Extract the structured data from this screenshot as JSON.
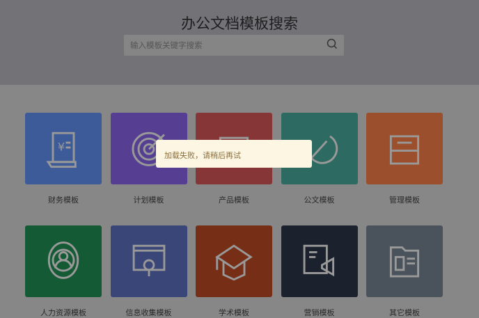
{
  "header": {
    "title": "办公文档模板搜索",
    "search_placeholder": "输入模板关键字搜索"
  },
  "categories": [
    {
      "label": "财务模板",
      "color": "#3c5b98"
    },
    {
      "label": "计划模板",
      "color": "#563f92"
    },
    {
      "label": "产品模板",
      "color": "#873638"
    },
    {
      "label": "公文模板",
      "color": "#2d6b62"
    },
    {
      "label": "管理模板",
      "color": "#9c4f2c"
    },
    {
      "label": "人力资源模板",
      "color": "#145a34"
    },
    {
      "label": "信息收集模板",
      "color": "#3a4677"
    },
    {
      "label": "学术模板",
      "color": "#772e17"
    },
    {
      "label": "营销模板",
      "color": "#1b222d"
    },
    {
      "label": "其它模板",
      "color": "#4a535c"
    }
  ],
  "toast": {
    "message": "加载失败，请稍后再试"
  }
}
